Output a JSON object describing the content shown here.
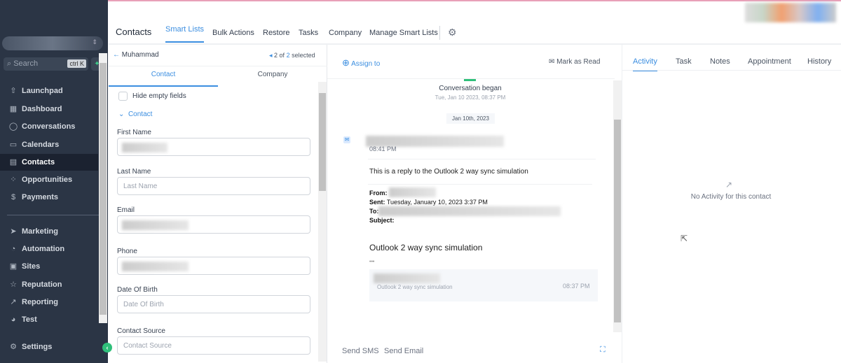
{
  "sidebar": {
    "search_placeholder": "Search",
    "shortcut": "ctrl K",
    "items": [
      {
        "label": "Launchpad",
        "icon": "rocket-icon"
      },
      {
        "label": "Dashboard",
        "icon": "grid-icon"
      },
      {
        "label": "Conversations",
        "icon": "chat-icon"
      },
      {
        "label": "Calendars",
        "icon": "calendar-icon"
      },
      {
        "label": "Contacts",
        "icon": "contacts-icon",
        "active": true
      },
      {
        "label": "Opportunities",
        "icon": "opportunities-icon"
      },
      {
        "label": "Payments",
        "icon": "payments-icon"
      },
      {
        "label": "Marketing",
        "icon": "send-icon"
      },
      {
        "label": "Automation",
        "icon": "automation-icon"
      },
      {
        "label": "Sites",
        "icon": "sites-icon"
      },
      {
        "label": "Reputation",
        "icon": "star-icon"
      },
      {
        "label": "Reporting",
        "icon": "trend-icon"
      },
      {
        "label": "Test",
        "icon": "test-icon"
      }
    ],
    "settings": "Settings"
  },
  "header": {
    "title": "Contacts",
    "tabs": [
      "Smart Lists",
      "Bulk Actions",
      "Restore",
      "Tasks",
      "Company",
      "Manage Smart Lists"
    ]
  },
  "contact_panel": {
    "back_name": "Muhammad",
    "pager_current": "2 of",
    "pager_total": "2",
    "pager_suffix": "selected",
    "tabs": [
      "Contact",
      "Company"
    ],
    "hide_empty": "Hide empty fields",
    "section": "Contact",
    "fields": [
      {
        "label": "First Name",
        "placeholder": ""
      },
      {
        "label": "Last Name",
        "placeholder": "Last Name"
      },
      {
        "label": "Email",
        "placeholder": ""
      },
      {
        "label": "Phone",
        "placeholder": ""
      },
      {
        "label": "Date Of Birth",
        "placeholder": "Date Of Birth"
      },
      {
        "label": "Contact Source",
        "placeholder": "Contact Source"
      }
    ]
  },
  "conversation": {
    "assign": "Assign to",
    "mark_read": "Mark as Read",
    "began": "Conversation began",
    "began_time": "Tue, Jan 10 2023, 08:37 PM",
    "date_chip": "Jan 10th, 2023",
    "msg_time": "08:41 PM",
    "body": "This is a reply to the Outlook 2 way sync simulation",
    "from": "From:",
    "sent_label": "Sent:",
    "sent": "Tuesday, January 10, 2023 3:37 PM",
    "to": "To:",
    "subject": "Subject:",
    "heading": "Outlook 2 way sync simulation",
    "ellipsis": "•••",
    "quote_text": "Outlook 2 way sync simulation",
    "quote_time": "08:37 PM",
    "send_sms": "Send SMS",
    "send_email": "Send Email"
  },
  "activity": {
    "tabs": [
      "Activity",
      "Task",
      "Notes",
      "Appointment",
      "History"
    ],
    "empty": "No Activity for this contact"
  },
  "colors": {
    "accent": "#3b8ee0",
    "sidebar": "#2b3545",
    "green": "#2fbf7a"
  }
}
